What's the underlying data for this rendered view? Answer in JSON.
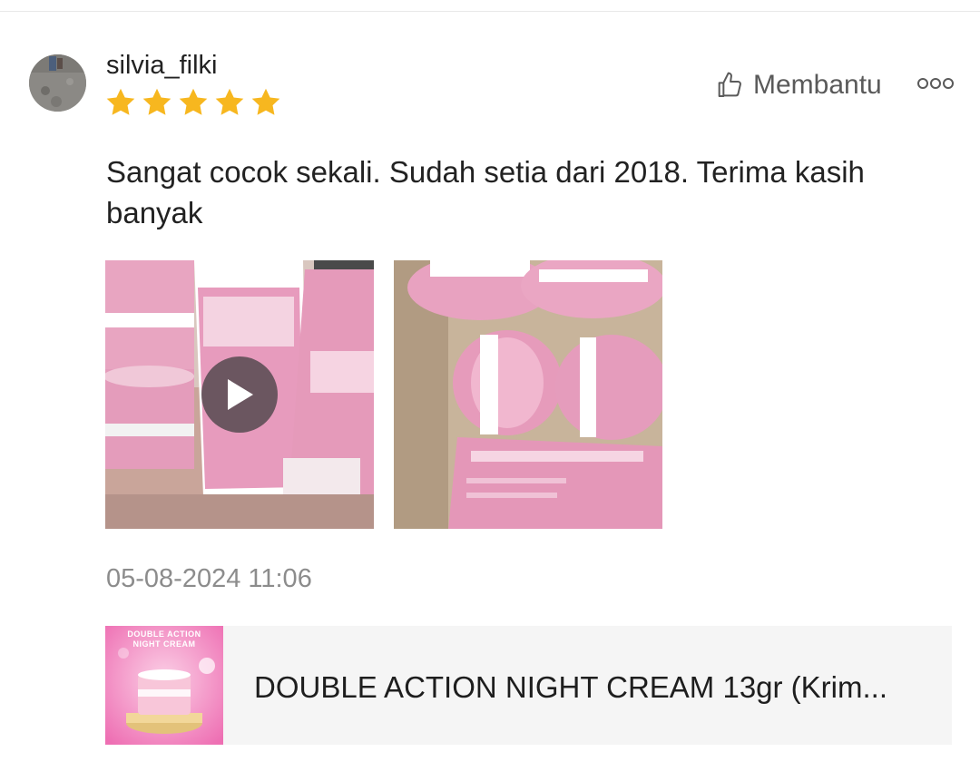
{
  "review": {
    "username": "silvia_filki",
    "rating": 5,
    "rating_max": 5,
    "helpful_label": "Membantu",
    "text": "Sangat cocok sekali. Sudah setia dari 2018. Terima kasih banyak",
    "timestamp": "05-08-2024 11:06",
    "media": [
      {
        "type": "video",
        "icon": "play-icon"
      },
      {
        "type": "image"
      }
    ]
  },
  "product": {
    "name": "DOUBLE ACTION NIGHT CREAM 13gr (Krim...",
    "thumb_caption_line1": "DOUBLE ACTION",
    "thumb_caption_line2": "NIGHT CREAM"
  },
  "icons": {
    "helpful": "thumbs-up-icon",
    "more": "more-options-icon",
    "star": "star-icon"
  },
  "colors": {
    "star": "#f7b71f",
    "helpful_text": "#5a5a5a",
    "timestamp": "#8c8c8c",
    "product_card_bg": "#f5f5f5",
    "media_pink": "#e6a1bd"
  }
}
